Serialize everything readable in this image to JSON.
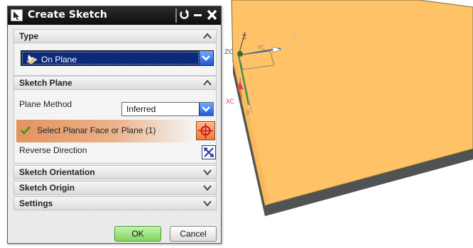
{
  "dialog": {
    "title": "Create Sketch",
    "buttons": {
      "reset": "reset-icon",
      "minimize": "minimize-icon",
      "close": "close-icon"
    }
  },
  "type_section": {
    "header": "Type",
    "selected_option": "On Plane"
  },
  "sketch_plane_section": {
    "header": "Sketch Plane",
    "plane_method_label": "Plane Method",
    "plane_method_value": "Inferred",
    "select_face_label": "Select Planar Face or Plane (1)",
    "reverse_direction_label": "Reverse Direction"
  },
  "collapsed_sections": [
    {
      "header": "Sketch Orientation"
    },
    {
      "header": "Sketch Origin"
    },
    {
      "header": "Settings"
    }
  ],
  "footer": {
    "ok_label": "OK",
    "cancel_label": "Cancel"
  },
  "viewport": {
    "axis_labels": {
      "z": "Z",
      "zc": "ZC",
      "yc": "YC",
      "xc": "XC",
      "x": "X",
      "y": "Y"
    },
    "colors": {
      "background": "#ffffff",
      "block_top": "#ffc266",
      "block_side": "#4f5354",
      "block_edge": "#6b6440"
    }
  }
}
